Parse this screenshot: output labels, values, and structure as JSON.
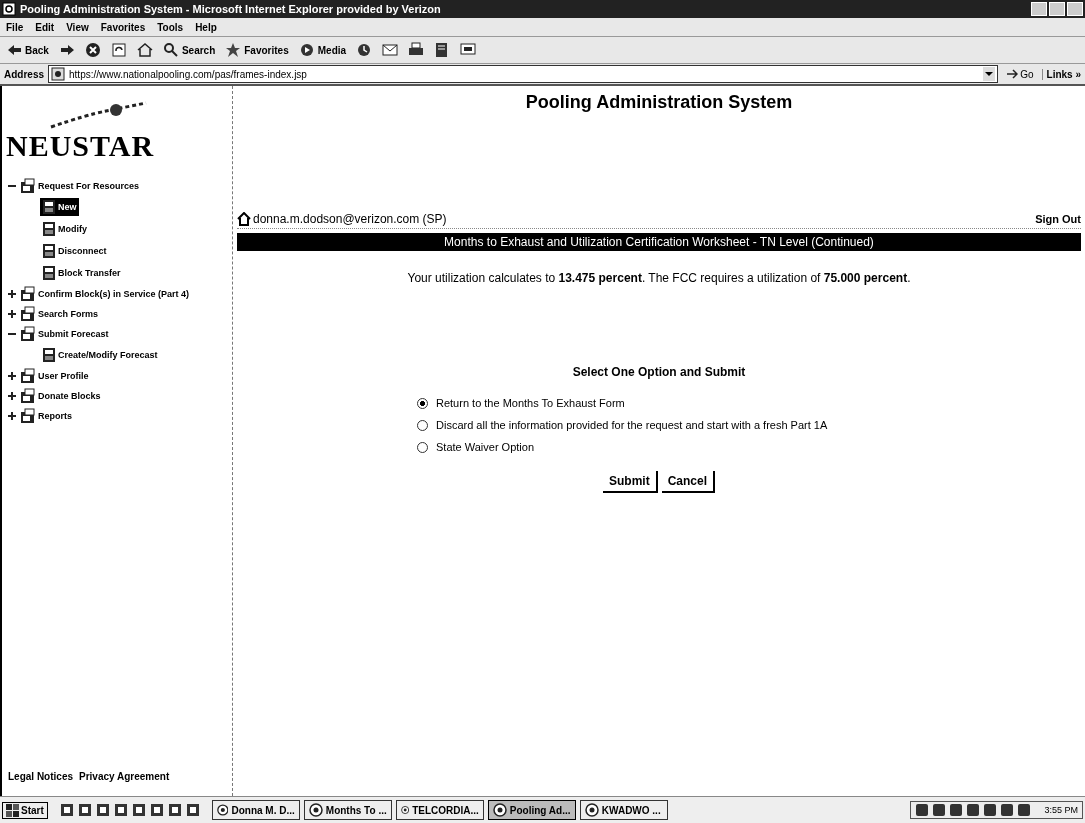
{
  "window": {
    "title": "Pooling Administration System - Microsoft Internet Explorer provided by Verizon"
  },
  "menu": [
    "File",
    "Edit",
    "View",
    "Favorites",
    "Tools",
    "Help"
  ],
  "toolbar": [
    {
      "kind": "back",
      "label": "Back"
    },
    {
      "kind": "forward"
    },
    {
      "kind": "stop"
    },
    {
      "kind": "refresh"
    },
    {
      "kind": "home"
    },
    {
      "kind": "search",
      "label": "Search"
    },
    {
      "kind": "favorites",
      "label": "Favorites"
    },
    {
      "kind": "media",
      "label": "Media"
    },
    {
      "kind": "history"
    },
    {
      "kind": "mail"
    },
    {
      "kind": "print"
    },
    {
      "kind": "edit"
    },
    {
      "kind": "discuss"
    }
  ],
  "address": {
    "label": "Address",
    "value": "https://www.nationalpooling.com/pas/frames-index.jsp",
    "go": "Go",
    "links": "Links »"
  },
  "sidebar": {
    "logo": "NEUSTAR",
    "items": [
      {
        "label": "Request For Resources",
        "expanded": true,
        "children": [
          {
            "label": "New",
            "selected": true
          },
          {
            "label": "Modify",
            "selected": false
          },
          {
            "label": "Disconnect",
            "selected": false
          },
          {
            "label": "Block Transfer",
            "selected": false
          }
        ]
      },
      {
        "label": "Confirm Block(s) in Service (Part 4)",
        "expanded": false
      },
      {
        "label": "Search Forms",
        "expanded": false
      },
      {
        "label": "Submit Forecast",
        "expanded": true,
        "children": [
          {
            "label": "Create/Modify Forecast",
            "selected": false
          }
        ]
      },
      {
        "label": "User Profile",
        "expanded": false
      },
      {
        "label": "Donate Blocks",
        "expanded": false
      },
      {
        "label": "Reports",
        "expanded": false
      }
    ],
    "footer_links": [
      "Legal Notices",
      "Privacy Agreement"
    ]
  },
  "page": {
    "title": "Pooling Administration System",
    "user": "donna.m.dodson@verizon.com (SP)",
    "sign_out": "Sign Out",
    "banner": "Months to Exhaust and Utilization Certification Worksheet - TN Level (Continued)",
    "message": "Your utilization calculates to **13.475 percent**. The FCC requires a utilization of **75.000 percent**.",
    "prompt": "Select One Option and Submit",
    "options": [
      {
        "label": "Return to the Months To Exhaust Form",
        "selected": true
      },
      {
        "label": "Discard all the information provided for the request and start with a fresh Part 1A",
        "selected": false
      },
      {
        "label": "State Waiver Option",
        "selected": false
      }
    ],
    "buttons": [
      "Submit",
      "Cancel"
    ]
  },
  "taskbar": {
    "start": "Start",
    "tasks": [
      {
        "label": "Donna M. D...",
        "selected": false
      },
      {
        "label": "Months To ...",
        "selected": false
      },
      {
        "label": "TELCORDIA...",
        "selected": false
      },
      {
        "label": "Pooling Ad...",
        "selected": true
      },
      {
        "label": "KWADWO ...",
        "selected": false
      }
    ],
    "clock": "3:55 PM"
  }
}
